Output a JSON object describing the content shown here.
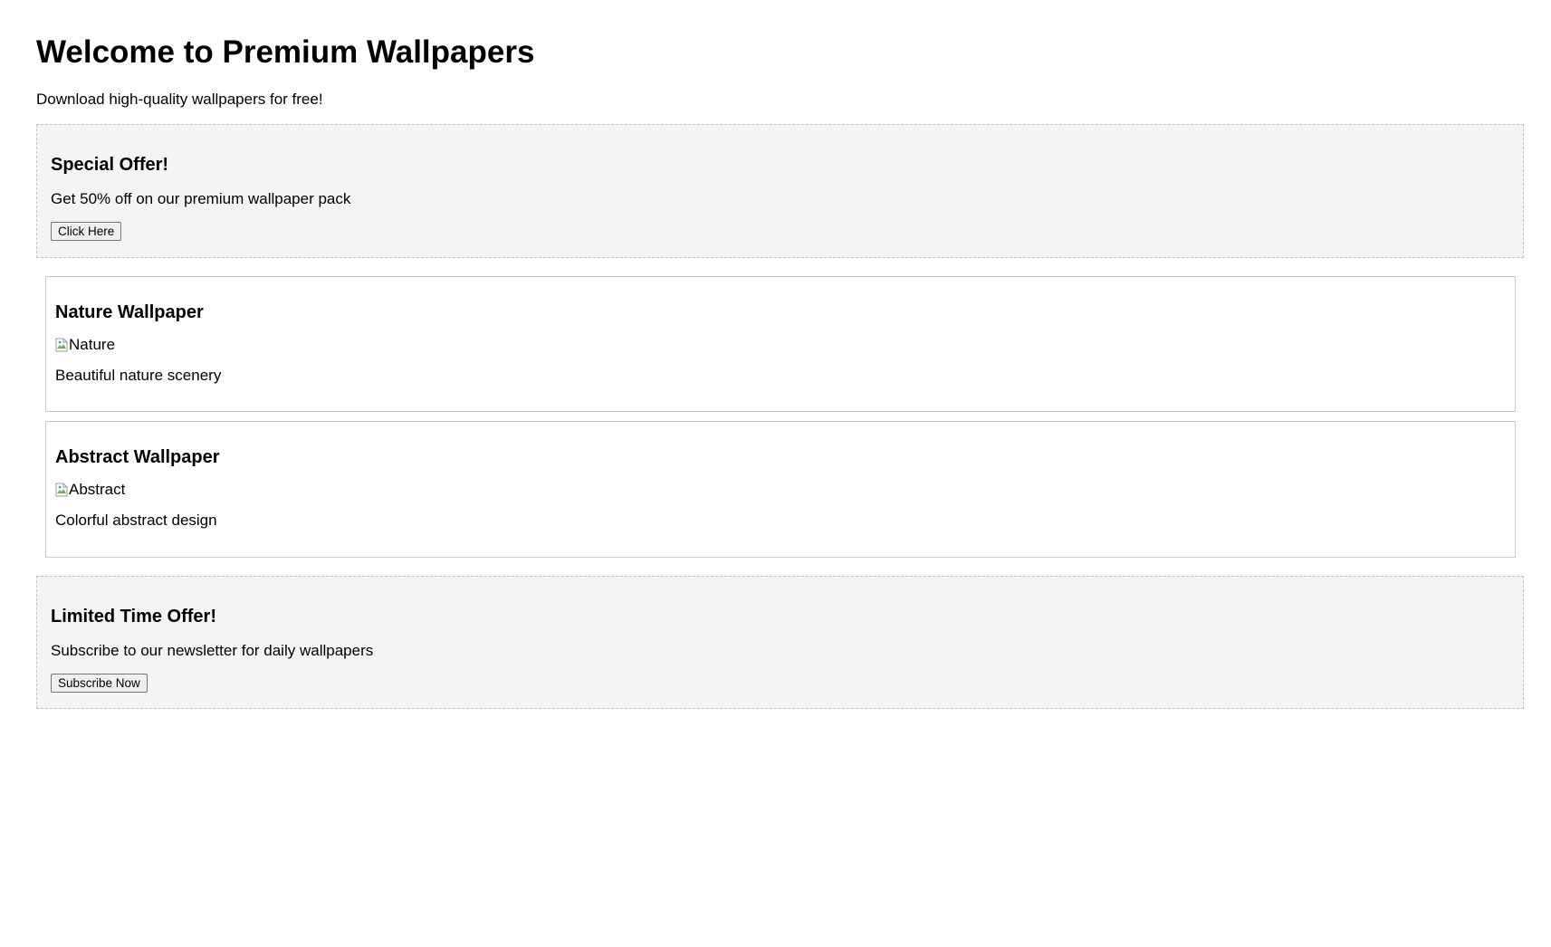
{
  "header": {
    "title": "Welcome to Premium Wallpapers",
    "subtitle": "Download high-quality wallpapers for free!"
  },
  "promo_top": {
    "heading": "Special Offer!",
    "text": "Get 50% off on our premium wallpaper pack",
    "button_label": "Click Here"
  },
  "wallpapers": [
    {
      "title": "Nature Wallpaper",
      "image_alt": "Nature",
      "description": "Beautiful nature scenery"
    },
    {
      "title": "Abstract Wallpaper",
      "image_alt": "Abstract",
      "description": "Colorful abstract design"
    }
  ],
  "promo_bottom": {
    "heading": "Limited Time Offer!",
    "text": "Subscribe to our newsletter for daily wallpapers",
    "button_label": "Subscribe Now"
  },
  "icons": {
    "broken_image": "broken-image-icon"
  },
  "colors": {
    "promo_background": "#f4f4f4",
    "promo_border": "#c4c4c4",
    "card_border": "#cccccc"
  }
}
